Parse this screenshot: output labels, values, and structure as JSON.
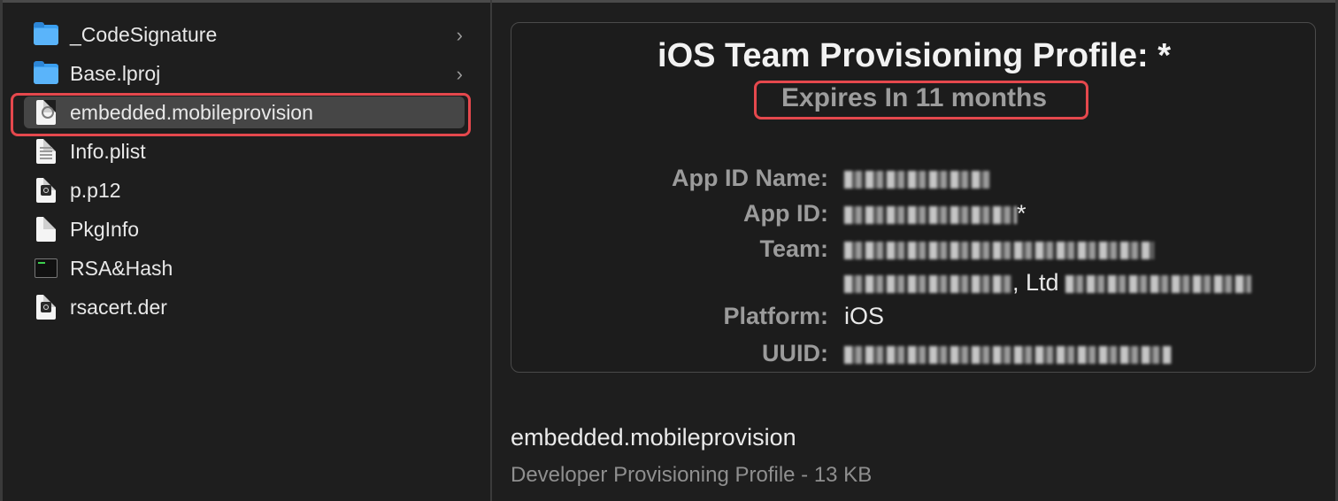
{
  "file_list": [
    {
      "label": "_CodeSignature",
      "icon": "folder-icon",
      "has_children": true,
      "selected": false
    },
    {
      "label": "Base.lproj",
      "icon": "folder-icon",
      "has_children": true,
      "selected": false
    },
    {
      "label": "embedded.mobileprovision",
      "icon": "provisioning-file-icon",
      "has_children": false,
      "selected": true
    },
    {
      "label": "Info.plist",
      "icon": "plist-file-icon",
      "has_children": false,
      "selected": false
    },
    {
      "label": "p.p12",
      "icon": "certificate-file-icon",
      "has_children": false,
      "selected": false
    },
    {
      "label": "PkgInfo",
      "icon": "blank-file-icon",
      "has_children": false,
      "selected": false
    },
    {
      "label": "RSA&Hash",
      "icon": "terminal-executable-icon",
      "has_children": false,
      "selected": false
    },
    {
      "label": "rsacert.der",
      "icon": "certificate-file-icon",
      "has_children": false,
      "selected": false
    }
  ],
  "chevron_glyph": "›",
  "preview": {
    "title": "iOS Team Provisioning Profile: *",
    "expires": "Expires In 11 months",
    "fields": {
      "app_id_name_label": "App ID Name:",
      "app_id_label": "App ID:",
      "app_id_suffix": "*",
      "team_label": "Team:",
      "team_value_visible": ", Ltd",
      "platform_label": "Platform:",
      "platform_value": "iOS",
      "uuid_label": "UUID:"
    }
  },
  "file_info": {
    "name": "embedded.mobileprovision",
    "description": "Developer Provisioning Profile - 13 KB"
  },
  "colors": {
    "selection": "#464646",
    "highlight_border": "#e5484d",
    "folder_blue": "#3a9ff0"
  }
}
